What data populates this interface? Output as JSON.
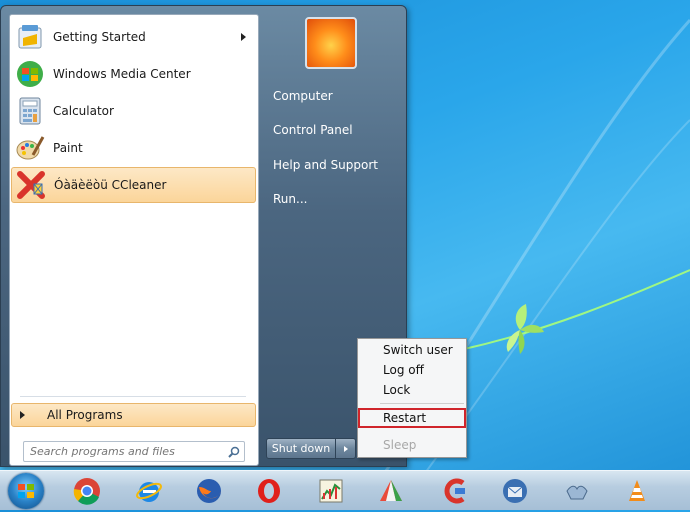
{
  "start_menu": {
    "programs": [
      {
        "label": "Getting Started",
        "icon": "getting-started-icon",
        "has_submenu": true
      },
      {
        "label": "Windows Media Center",
        "icon": "media-center-icon",
        "has_submenu": false
      },
      {
        "label": "Calculator",
        "icon": "calculator-icon",
        "has_submenu": false
      },
      {
        "label": "Paint",
        "icon": "paint-icon",
        "has_submenu": false
      },
      {
        "label": "Óàäèëòü CCleaner",
        "icon": "ccleaner-uninstall-icon",
        "has_submenu": false,
        "highlighted": true
      }
    ],
    "all_programs_label": "All Programs",
    "search_placeholder": "Search programs and files",
    "right_links": [
      "Computer",
      "Control Panel",
      "Help and Support",
      "Run..."
    ],
    "shutdown_label": "Shut down"
  },
  "power_menu": {
    "items": [
      {
        "label": "Switch user",
        "enabled": true
      },
      {
        "label": "Log off",
        "enabled": true
      },
      {
        "label": "Lock",
        "enabled": true
      },
      {
        "label": "Restart",
        "enabled": true,
        "highlighted": true
      },
      {
        "label": "Sleep",
        "enabled": false
      }
    ],
    "highlight_color": "#d0252b"
  },
  "taskbar": {
    "icons": [
      "start-orb-icon",
      "chrome-icon",
      "internet-explorer-icon",
      "firefox-icon",
      "opera-icon",
      "chart-app-icon",
      "tent-app-icon",
      "ccleaner-icon",
      "thunderbird-icon",
      "hands-app-icon",
      "vlc-icon"
    ]
  }
}
